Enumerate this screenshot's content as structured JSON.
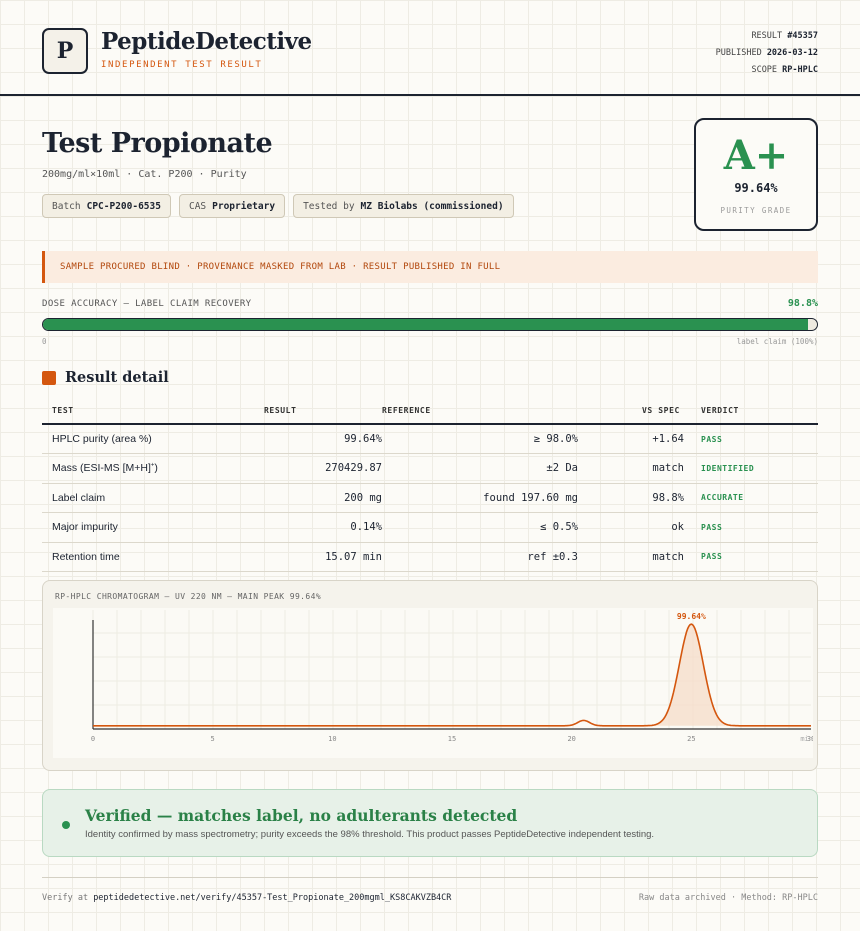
{
  "brand": {
    "logo_letter": "P",
    "name": "PeptideDetective",
    "tagline": "INDEPENDENT TEST RESULT"
  },
  "meta": {
    "result_label": "RESULT",
    "result_id": "#45357",
    "published_label": "PUBLISHED",
    "published_date": "2026-03-12",
    "scope_label": "SCOPE",
    "scope_value": "RP-HPLC"
  },
  "product": {
    "title": "Test Propionate",
    "subtitle": "200mg/ml×10ml · Cat. P200 · Purity",
    "chips": [
      {
        "label": "Batch",
        "value": "CPC-P200-6535"
      },
      {
        "label": "CAS",
        "value": "Proprietary"
      },
      {
        "label": "Tested by",
        "value": "MZ Biolabs (commissioned)"
      }
    ]
  },
  "grade": {
    "letter": "A+",
    "value": "99.64%",
    "label": "PURITY GRADE",
    "color": "#2a9150"
  },
  "notice": "SAMPLE PROCURED BLIND · PROVENANCE MASKED FROM LAB · RESULT PUBLISHED IN FULL",
  "dose": {
    "label": "DOSE ACCURACY — LABEL CLAIM RECOVERY",
    "value": "98.8%",
    "fraction": 0.988,
    "min_label": "0",
    "max_label": "label claim (100%)"
  },
  "results": {
    "section_title": "Result detail",
    "headers": [
      "TEST",
      "RESULT",
      "REFERENCE",
      "VS SPEC",
      "VERDICT"
    ],
    "rows": [
      {
        "test": "HPLC purity (area %)",
        "result": "99.64%",
        "reference": "≥ 98.0%",
        "vs_spec": "+1.64",
        "verdict": "PASS"
      },
      {
        "test": "Mass (ESI-MS [M+H]",
        "test_sup": "+",
        "test_close": ")",
        "result": "270429.87",
        "reference": "±2 Da",
        "vs_spec": "match",
        "verdict": "IDENTIFIED"
      },
      {
        "test": "Label claim",
        "result": "200 mg",
        "reference": "found 197.60 mg",
        "vs_spec": "98.8%",
        "verdict": "ACCURATE"
      },
      {
        "test": "Major impurity",
        "result": "0.14%",
        "reference": "≤ 0.5%",
        "vs_spec": "ok",
        "verdict": "PASS"
      },
      {
        "test": "Retention time",
        "result": "15.07 min",
        "reference": "ref ±0.3",
        "vs_spec": "match",
        "verdict": "PASS"
      }
    ]
  },
  "chromatogram": {
    "title": "RP-HPLC CHROMATOGRAM — UV 220 NM — MAIN PEAK 99.64%",
    "x_ticks": [
      "0",
      "5",
      "10",
      "15",
      "20",
      "25",
      "30"
    ],
    "x_unit": "min",
    "peak_label": "99.64%",
    "line_color": "#d4570f"
  },
  "chart_data": {
    "type": "line",
    "title": "RP-HPLC CHROMATOGRAM — UV 220 NM — MAIN PEAK 99.64%",
    "xlabel": "min",
    "ylabel": "",
    "xlim": [
      0,
      30
    ],
    "ylim": [
      0,
      1
    ],
    "x_ticks": [
      0,
      5,
      10,
      15,
      20,
      25,
      30
    ],
    "series": [
      {
        "x": [
          0,
          5,
          10,
          15,
          19.5,
          20.2,
          20.5,
          21.2,
          23,
          24,
          24.5,
          25.0,
          25.5,
          26,
          27,
          30
        ],
        "y": [
          0.03,
          0.03,
          0.03,
          0.03,
          0.03,
          0.07,
          0.08,
          0.03,
          0.04,
          0.22,
          0.62,
          0.98,
          0.62,
          0.22,
          0.03,
          0.03
        ]
      }
    ],
    "annotations": [
      {
        "x": 25.0,
        "text": "99.64%"
      }
    ],
    "grid": true
  },
  "verified": {
    "title": "Verified — matches label, no adulterants detected",
    "description": "Identity confirmed by mass spectrometry; purity exceeds the 98% threshold. This product passes PeptideDetective independent testing.",
    "color": "#2a9150"
  },
  "footer": {
    "verify_prefix": "Verify at",
    "verify_url": "peptidedetective.net/verify/45357-Test_Propionate_200mgml_KS8CAKVZB4CR",
    "right_text": "Raw data archived · Method: RP-HPLC"
  }
}
